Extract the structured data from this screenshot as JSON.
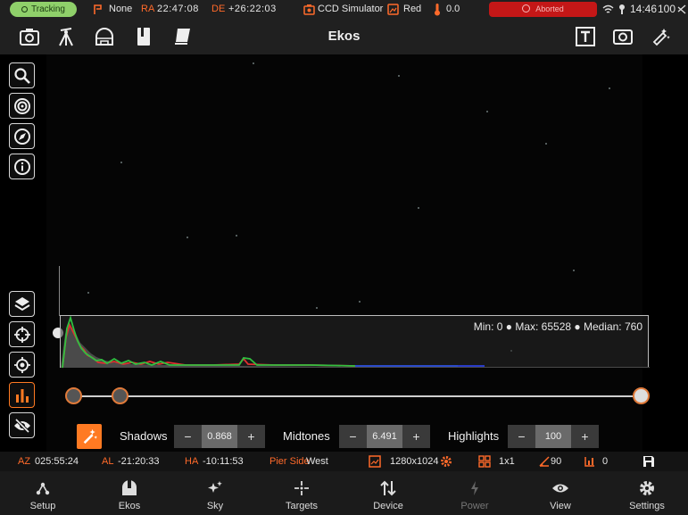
{
  "status": {
    "tracking": "Tracking",
    "mount_park": "None",
    "ra_label": "RA",
    "ra_value": "22:47:08",
    "de_label": "DE",
    "de_value": "+26:22:03",
    "camera": "CCD Simulator",
    "filter": "Red",
    "temperature": "0.0",
    "job_state": "Aborted",
    "clock": "14:46",
    "battery": "100"
  },
  "toolbar": {
    "title": "Ekos"
  },
  "histogram": {
    "stats": "Min: 0 ● Max: 65528 ● Median: 760"
  },
  "stretch": {
    "shadows_label": "Shadows",
    "shadows_value": "0.868",
    "midtones_label": "Midtones",
    "midtones_value": "6.491",
    "highlights_label": "Highlights",
    "highlights_value": "100",
    "minus": "−",
    "plus": "+"
  },
  "infobar": {
    "az_label": "AZ",
    "az_value": "025:55:24",
    "al_label": "AL",
    "al_value": "-21:20:33",
    "ha_label": "HA",
    "ha_value": "-10:11:53",
    "pier_label": "Pier Side",
    "pier_value": "West",
    "resolution": "1280x1024",
    "binning": "1x1",
    "rotation": "90",
    "offset": "0"
  },
  "nav": [
    {
      "label": "Setup",
      "icon": "setup-icon"
    },
    {
      "label": "Ekos",
      "icon": "ekos-icon"
    },
    {
      "label": "Sky",
      "icon": "sky-icon"
    },
    {
      "label": "Targets",
      "icon": "targets-icon"
    },
    {
      "label": "Device",
      "icon": "device-icon"
    },
    {
      "label": "Power",
      "icon": "power-icon"
    },
    {
      "label": "View",
      "icon": "view-icon"
    },
    {
      "label": "Settings",
      "icon": "settings-icon"
    }
  ],
  "colors": {
    "accent": "#ff7a22",
    "tracking": "#8fd06a",
    "aborted": "#c41717",
    "hist_red": "#e03030",
    "hist_green": "#30c040",
    "hist_blue": "#2a40e0"
  }
}
